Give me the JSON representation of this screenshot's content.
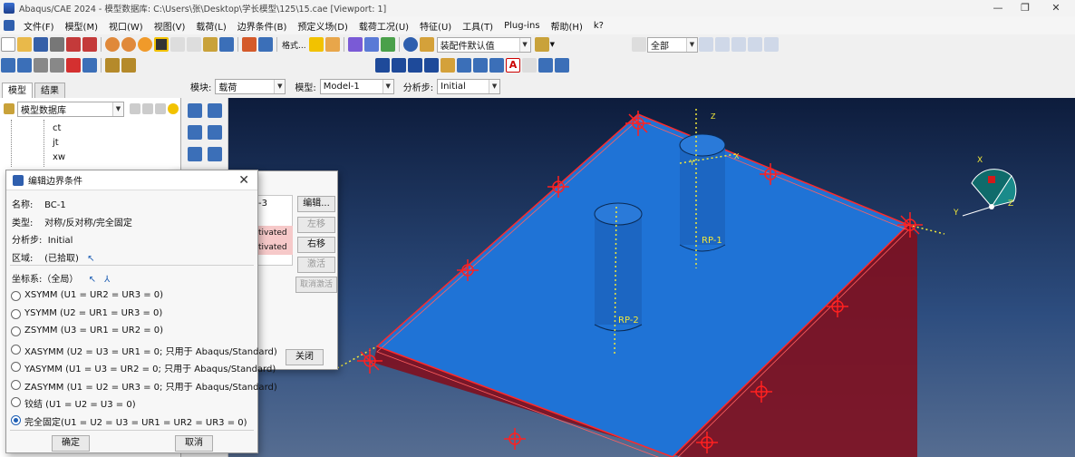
{
  "titlebar": {
    "title": "Abaqus/CAE 2024 - 模型数据库: C:\\Users\\张\\Desktop\\学长模型\\125\\15.cae [Viewport: 1]",
    "min": "—",
    "max": "❐",
    "close": "✕"
  },
  "menu": [
    "文件(F)",
    "模型(M)",
    "视口(W)",
    "视图(V)",
    "载荷(L)",
    "边界条件(B)",
    "预定义场(D)",
    "载荷工况(U)",
    "特征(U)",
    "工具(T)",
    "Plug-ins",
    "帮助(H)",
    "k?"
  ],
  "toolbar": {
    "assembly_combo": "装配件默认值",
    "select_combo": "全部",
    "partial_label": "格式..."
  },
  "context": {
    "module_label": "模块:",
    "module_value": "载荷",
    "model_label": "模型:",
    "model_value": "Model-1",
    "step_label": "分析步:",
    "step_value": "Initial"
  },
  "left": {
    "tabs": [
      "模型",
      "结果"
    ],
    "db_combo": "模型数据库",
    "tree": [
      "ct",
      "jt",
      "xw"
    ]
  },
  "manager": {
    "row1": "-3",
    "row2": "tivated",
    "row3": "tivated",
    "buttons": [
      "编辑...",
      "左移",
      "右移",
      "激活",
      "取消激活"
    ],
    "close": "关闭"
  },
  "dialog": {
    "title": "编辑边界条件",
    "name_label": "名称:",
    "name_value": "BC-1",
    "type_label": "类型:",
    "type_value": "对称/反对称/完全固定",
    "step_label": "分析步:",
    "step_value": "Initial",
    "region_label": "区域:",
    "region_value": "(已拾取)",
    "csys_label": "坐标系:（全局）",
    "options": [
      "XSYMM (U1 = UR2 = UR3 = 0)",
      "YSYMM (U2 = UR1 = UR3 = 0)",
      "ZSYMM (U3 = UR1 = UR2 = 0)",
      "XASYMM (U2 = U3 = UR1 = 0; 只用于 Abaqus/Standard)",
      "YASYMM (U1 = U3 = UR2 = 0; 只用于 Abaqus/Standard)",
      "ZASYMM (U1 = U2 = UR3 = 0; 只用于 Abaqus/Standard)",
      "铰结 (U1 = U2 = U3 = 0)",
      "完全固定(U1 = U2 = U3 = UR1 = UR2 = UR3 = 0)"
    ],
    "selected_index": 7,
    "ok": "确定",
    "cancel": "取消"
  },
  "viewport": {
    "rp1": "RP-1",
    "rp2": "RP-2",
    "triad": {
      "x": "X",
      "y": "Y",
      "z": "Z"
    },
    "col_axes": {
      "z": "Z",
      "y": "Y",
      "x": "X"
    }
  },
  "colors": {
    "plate": "#1f73d6",
    "bc": "#ff1a1a",
    "bg_top": "#0d1c3c",
    "bg_bottom": "#566d91",
    "accent": "#1f5fb4"
  }
}
